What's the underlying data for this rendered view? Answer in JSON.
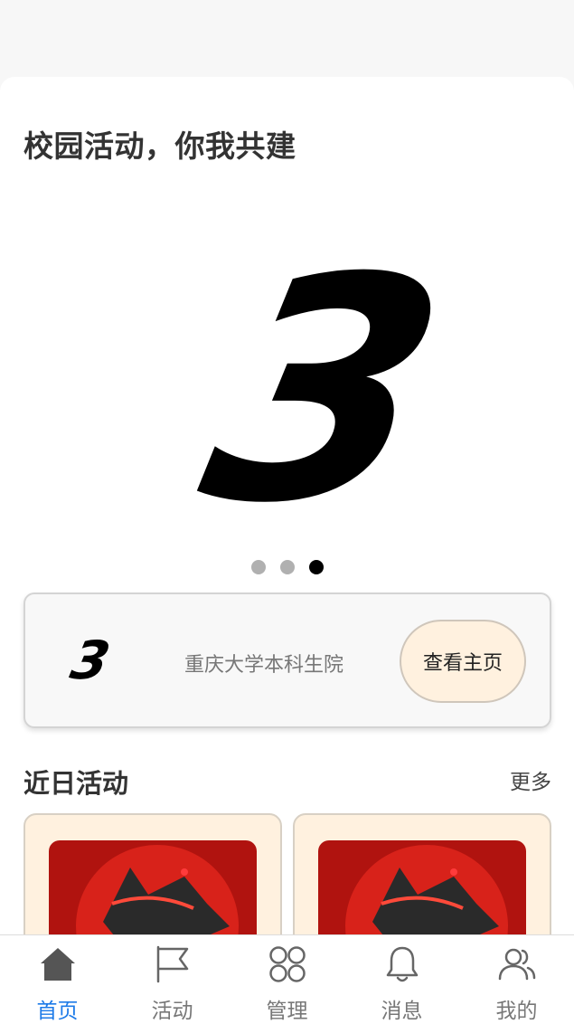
{
  "header": {
    "title": "校园活动，你我共建"
  },
  "banner": {
    "logo_text": "3",
    "slide_count": 3,
    "active_slide": 3
  },
  "org_card": {
    "logo_text": "3",
    "name": "重庆大学本科生院",
    "home_button_label": "查看主页"
  },
  "recent": {
    "title": "近日活动",
    "more_label": "更多",
    "cards": [
      {
        "image": "red-wolf-emblem"
      },
      {
        "image": "red-wolf-emblem"
      }
    ]
  },
  "tabbar": {
    "active": "home",
    "items": [
      {
        "id": "home",
        "label": "首页",
        "icon": "home-icon"
      },
      {
        "id": "activity",
        "label": "活动",
        "icon": "flag-icon"
      },
      {
        "id": "manage",
        "label": "管理",
        "icon": "grid-icon"
      },
      {
        "id": "messages",
        "label": "消息",
        "icon": "bell-icon"
      },
      {
        "id": "mine",
        "label": "我的",
        "icon": "users-icon"
      }
    ]
  },
  "colors": {
    "accent": "#1e7be8",
    "button_bg": "#fff1df",
    "card_bg": "#fff1df",
    "dot_inactive": "#b0b0b0",
    "dot_active": "#000000"
  }
}
